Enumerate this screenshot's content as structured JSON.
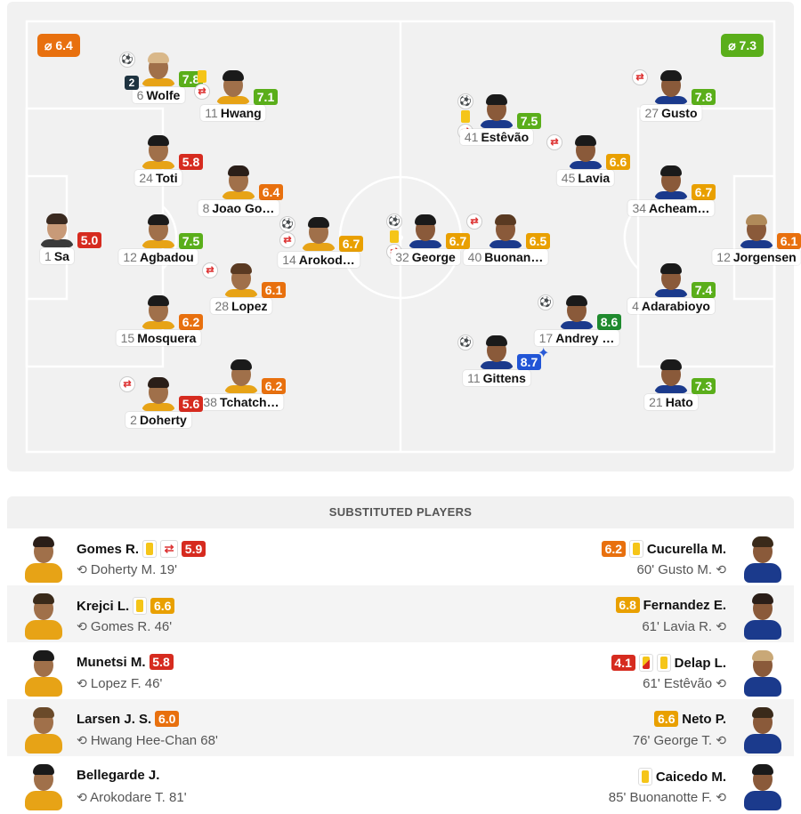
{
  "colors": {
    "red": "#d62b1f",
    "orange": "#e8700e",
    "amber": "#e9a000",
    "lightgreen": "#5aae1a",
    "darkgreen": "#1f8a2e",
    "blue": "#2155d6"
  },
  "pitch": {
    "home_avg": "⌀ 6.4",
    "home_avg_color": "#e8700e",
    "away_avg": "⌀ 7.3",
    "away_avg_color": "#5aae1a",
    "players": [
      {
        "num": "6",
        "name": "Wolfe",
        "rating": "7.8",
        "color": "#5aae1a",
        "goals": "2",
        "icons": [
          "assist"
        ],
        "kit": "wolves",
        "hair": "#d9b88a"
      },
      {
        "num": "11",
        "name": "Hwang",
        "rating": "7.1",
        "color": "#5aae1a",
        "icons": [
          "card",
          "sub"
        ],
        "kit": "wolves",
        "hair": "#1a1a1a"
      },
      {
        "num": "24",
        "name": "Toti",
        "rating": "5.8",
        "color": "#d62b1f",
        "icons": [],
        "kit": "wolves",
        "hair": "#1a1a1a"
      },
      {
        "num": "8",
        "name": "Joao Go…",
        "rating": "6.4",
        "color": "#e8700e",
        "icons": [],
        "kit": "wolves",
        "hair": "#2a1e18"
      },
      {
        "num": "1",
        "name": "Sa",
        "rating": "5.0",
        "color": "#d62b1f",
        "icons": [],
        "kit": "gk",
        "hair": "#3a2a20"
      },
      {
        "num": "12",
        "name": "Agbadou",
        "rating": "7.5",
        "color": "#5aae1a",
        "icons": [],
        "kit": "wolves",
        "hair": "#1a1a1a"
      },
      {
        "num": "14",
        "name": "Arokod…",
        "rating": "6.7",
        "color": "#e9a000",
        "icons": [
          "assist",
          "sub"
        ],
        "kit": "wolves",
        "hair": "#1a1a1a"
      },
      {
        "num": "28",
        "name": "Lopez",
        "rating": "6.1",
        "color": "#e8700e",
        "icons": [
          "sub"
        ],
        "kit": "wolves",
        "hair": "#5a3a22"
      },
      {
        "num": "15",
        "name": "Mosquera",
        "rating": "6.2",
        "color": "#e8700e",
        "icons": [],
        "kit": "wolves",
        "hair": "#1a1a1a"
      },
      {
        "num": "38",
        "name": "Tchatch…",
        "rating": "6.2",
        "color": "#e8700e",
        "icons": [],
        "kit": "wolves",
        "hair": "#1a1a1a"
      },
      {
        "num": "2",
        "name": "Doherty",
        "rating": "5.6",
        "color": "#d62b1f",
        "icons": [
          "sub"
        ],
        "kit": "wolves",
        "hair": "#2a1e18"
      },
      {
        "num": "41",
        "name": "Estêvão",
        "rating": "7.5",
        "color": "#5aae1a",
        "icons": [
          "assist",
          "card",
          "sub"
        ],
        "kit": "chelsea",
        "hair": "#1a1a1a"
      },
      {
        "num": "27",
        "name": "Gusto",
        "rating": "7.8",
        "color": "#5aae1a",
        "icons": [
          "sub"
        ],
        "kit": "chelsea",
        "hair": "#1a1a1a"
      },
      {
        "num": "45",
        "name": "Lavia",
        "rating": "6.6",
        "color": "#e9a000",
        "icons": [
          "sub"
        ],
        "kit": "chelsea",
        "hair": "#1a1a1a"
      },
      {
        "num": "34",
        "name": "Acheam…",
        "rating": "6.7",
        "color": "#e9a000",
        "icons": [],
        "kit": "chelsea",
        "hair": "#1a1a1a"
      },
      {
        "num": "32",
        "name": "George",
        "rating": "6.7",
        "color": "#e9a000",
        "icons": [
          "assist",
          "card",
          "sub"
        ],
        "kit": "chelsea",
        "hair": "#1a1a1a"
      },
      {
        "num": "40",
        "name": "Buonan…",
        "rating": "6.5",
        "color": "#e9a000",
        "icons": [
          "sub"
        ],
        "kit": "chelsea",
        "hair": "#5a3a22"
      },
      {
        "num": "12",
        "name": "Jorgensen",
        "rating": "6.1",
        "color": "#e8700e",
        "icons": [],
        "kit": "chelsea",
        "hair": "#b08a5a"
      },
      {
        "num": "4",
        "name": "Adarabioyo",
        "rating": "7.4",
        "color": "#5aae1a",
        "icons": [],
        "kit": "chelsea",
        "hair": "#1a1a1a"
      },
      {
        "num": "17",
        "name": "Andrey …",
        "rating": "8.6",
        "color": "#1f8a2e",
        "icons": [
          "assist"
        ],
        "kit": "chelsea",
        "hair": "#1a1a1a"
      },
      {
        "num": "11",
        "name": "Gittens",
        "rating": "8.7",
        "color": "#2155d6",
        "icons": [
          "assist"
        ],
        "kit": "chelsea",
        "hair": "#1a1a1a",
        "star": true
      },
      {
        "num": "21",
        "name": "Hato",
        "rating": "7.3",
        "color": "#5aae1a",
        "icons": [],
        "kit": "chelsea",
        "hair": "#1a1a1a"
      }
    ]
  },
  "subs": {
    "header": "SUBSTITUTED PLAYERS",
    "rows": [
      {
        "left": {
          "name": "Gomes R.",
          "rating": "5.9",
          "color": "#d62b1f",
          "events": [
            "ycard",
            "sub"
          ],
          "detail": "Doherty M. 19'",
          "hair": "#2a1e18"
        },
        "right": {
          "name": "Cucurella M.",
          "rating": "6.2",
          "color": "#e8700e",
          "events": [
            "ycard"
          ],
          "detail": "60' Gusto M.",
          "hair": "#3a2a1a"
        }
      },
      {
        "left": {
          "name": "Krejci L.",
          "rating": "6.6",
          "color": "#e9a000",
          "events": [
            "ycard"
          ],
          "detail": "Gomes R. 46'",
          "hair": "#3a2a1a"
        },
        "right": {
          "name": "Fernandez E.",
          "rating": "6.8",
          "color": "#e9a000",
          "events": [],
          "detail": "61' Lavia R.",
          "hair": "#2a1e18"
        }
      },
      {
        "left": {
          "name": "Munetsi M.",
          "rating": "5.8",
          "color": "#d62b1f",
          "events": [],
          "detail": "Lopez F. 46'",
          "hair": "#1a1a1a"
        },
        "right": {
          "name": "Delap L.",
          "rating": "4.1",
          "color": "#d62b1f",
          "events": [
            "rcard",
            "ycard"
          ],
          "detail": "61' Estêvão",
          "hair": "#c9a877"
        }
      },
      {
        "left": {
          "name": "Larsen J. S.",
          "rating": "6.0",
          "color": "#e8700e",
          "events": [],
          "detail": "Hwang Hee-Chan 68'",
          "hair": "#6a4a2a"
        },
        "right": {
          "name": "Neto P.",
          "rating": "6.6",
          "color": "#e9a000",
          "events": [],
          "detail": "76' George T.",
          "hair": "#3a2a1a"
        }
      },
      {
        "left": {
          "name": "Bellegarde J.",
          "rating": "",
          "color": "",
          "events": [],
          "detail": "Arokodare T. 81'",
          "hair": "#1a1a1a"
        },
        "right": {
          "name": "Caicedo M.",
          "rating": "",
          "color": "",
          "events": [
            "ycard"
          ],
          "detail": "85' Buonanotte F.",
          "hair": "#1a1a1a"
        }
      }
    ]
  }
}
